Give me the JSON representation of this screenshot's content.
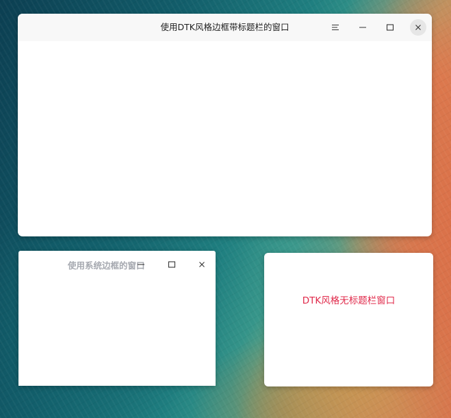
{
  "windows": {
    "dtk_titlebar": {
      "title": "使用DTK风格边框带标题栏的窗口",
      "buttons": [
        "menu-icon",
        "minimize-icon",
        "maximize-icon",
        "close-icon"
      ]
    },
    "system_frame": {
      "title": "使用系统边框的窗口",
      "buttons": [
        "minimize-icon",
        "maximize-icon",
        "close-icon"
      ]
    },
    "dtk_no_titlebar": {
      "label": "DTK风格无标题栏窗口"
    }
  },
  "colors": {
    "label_red": "#e0294a",
    "system_title_gray": "#a6a9b0",
    "titlebar_bg": "#f8f8f8"
  }
}
